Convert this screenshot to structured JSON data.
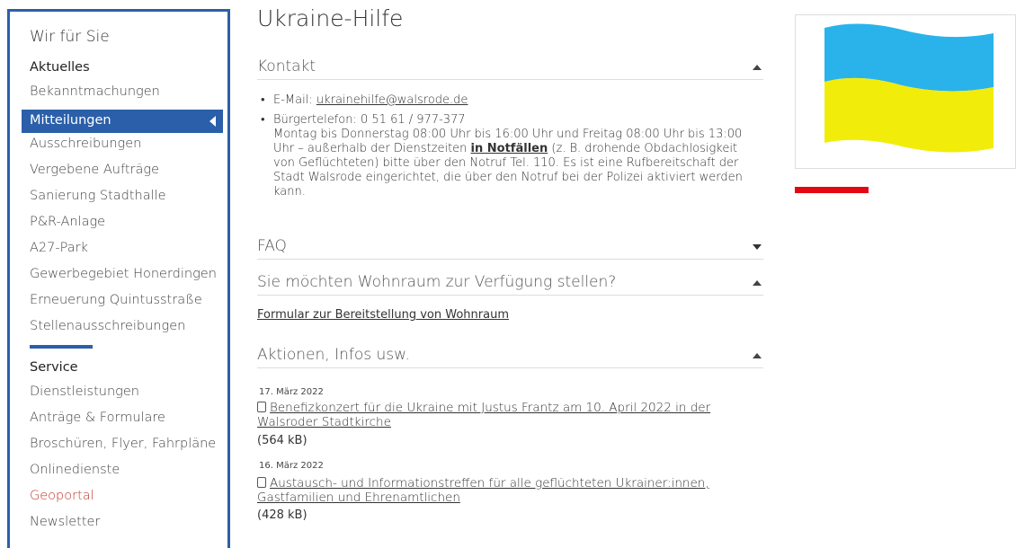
{
  "sidebar": {
    "title": "Wir für Sie",
    "section1_title": "Aktuelles",
    "items": [
      {
        "label": "Bekanntmachungen"
      },
      {
        "label": "Mitteilungen"
      },
      {
        "label": "Ausschreibungen"
      },
      {
        "label": "Vergebene Aufträge"
      },
      {
        "label": "Sanierung Stadthalle"
      },
      {
        "label": "P&R-Anlage"
      },
      {
        "label": "A27-Park"
      },
      {
        "label": "Gewerbegebiet Honerdingen"
      },
      {
        "label": "Erneuerung Quintusstraße"
      },
      {
        "label": "Stellenausschreibungen"
      }
    ],
    "active_index": 1,
    "section2_title": "Service",
    "service_items": [
      {
        "label": "Dienstleistungen"
      },
      {
        "label": "Anträge & Formulare"
      },
      {
        "label": "Broschüren, Flyer, Fahrpläne"
      },
      {
        "label": "Onlinedienste"
      },
      {
        "label": "Geoportal"
      },
      {
        "label": "Newsletter"
      }
    ]
  },
  "main": {
    "title": "Ukraine-Hilfe",
    "kontakt": {
      "heading": "Kontakt",
      "email_label": "E-Mail: ",
      "email": "ukrainehilfe@walsrode.de",
      "phone_line": "Bürgertelefon: 0 51 61 / 977-377",
      "hours_pre": "Montag bis Donnerstag 08:00 Uhr bis 16:00 Uhr und Freitag 08:00 Uhr bis 13:00 Uhr – außerhalb der Dienstzeiten ",
      "emergency": "in Notfällen",
      "hours_post": " (z. B. drohende Obdachlosigkeit von Geflüchteten) bitte über den Notruf Tel. 110. Es ist eine Rufbereitschaft der Stadt Walsrode eingerichtet, die über den Notruf bei der Polizei aktiviert werden kann."
    },
    "faq": {
      "heading": "FAQ"
    },
    "wohnraum": {
      "heading": "Sie möchten Wohnraum zur Verfügung stellen?",
      "link": "Formular zur Bereitstellung von Wohnraum"
    },
    "aktionen": {
      "heading": "Aktionen, Infos usw.",
      "docs": [
        {
          "date": "17. März 2022",
          "title": "Benefizkonzert für die Ukraine mit Justus Frantz am 10. April 2022 in der Walsroder Stadtkirche",
          "size": "(564 kB)"
        },
        {
          "date": "16. März 2022",
          "title": "Austausch- und Informationstreffen für alle geflüchteten Ukrainer:innen, Gastfamilien und Ehrenamtlichen",
          "size": "(428 kB)"
        }
      ]
    }
  },
  "aside": {
    "flag_colors": {
      "top": "#29b3ea",
      "bottom": "#f2ec0a"
    },
    "accent_bar_color": "#e30613"
  }
}
